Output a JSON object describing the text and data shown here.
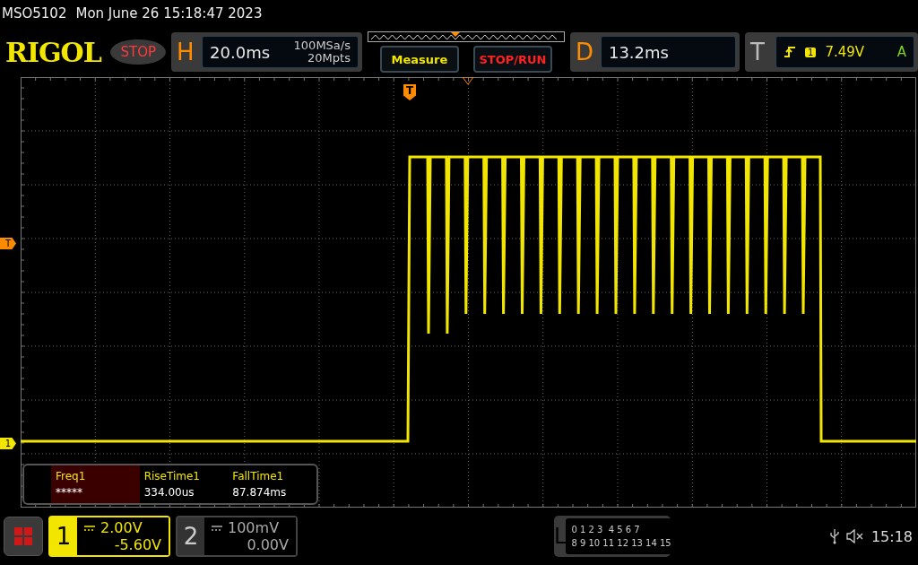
{
  "status": {
    "model": "MSO5102",
    "datetime": "Mon June 26 15:18:47 2023"
  },
  "toolbar": {
    "logo": "RIGOL",
    "run_state": "STOP",
    "horizontal": {
      "label": "H",
      "timebase": "20.0ms",
      "sample_rate": "100MSa/s",
      "memory_depth": "20Mpts"
    },
    "buttons": [
      {
        "label": "Measure",
        "kind": "measure"
      },
      {
        "label": "STOP/RUN",
        "kind": "stoprun"
      }
    ],
    "delay": {
      "label": "D",
      "value": "13.2ms"
    },
    "trigger": {
      "label": "T",
      "source": "1",
      "voltage": "7.49V",
      "mode": "A"
    }
  },
  "screen": {
    "trigger_marker": "T",
    "markers": [
      {
        "label": "T",
        "kind": "trigger"
      },
      {
        "label": "1",
        "kind": "channel"
      }
    ]
  },
  "measurements": [
    {
      "name": "Freq1",
      "value": "*****",
      "selected": true
    },
    {
      "name": "RiseTime1",
      "value": "334.00us",
      "selected": false
    },
    {
      "name": "FallTime1",
      "value": "87.874ms",
      "selected": false
    }
  ],
  "channels": [
    {
      "number": "1",
      "scale": "2.00V",
      "offset": "-5.60V",
      "selected": true
    },
    {
      "number": "2",
      "scale": "100mV",
      "offset": "0.00V",
      "selected": false
    }
  ],
  "logic": {
    "label": "L",
    "rows": [
      "0 1 2 3  4 5 6 7",
      "8 9 10 11 12 13 14 15"
    ]
  },
  "clock": "15:18"
}
